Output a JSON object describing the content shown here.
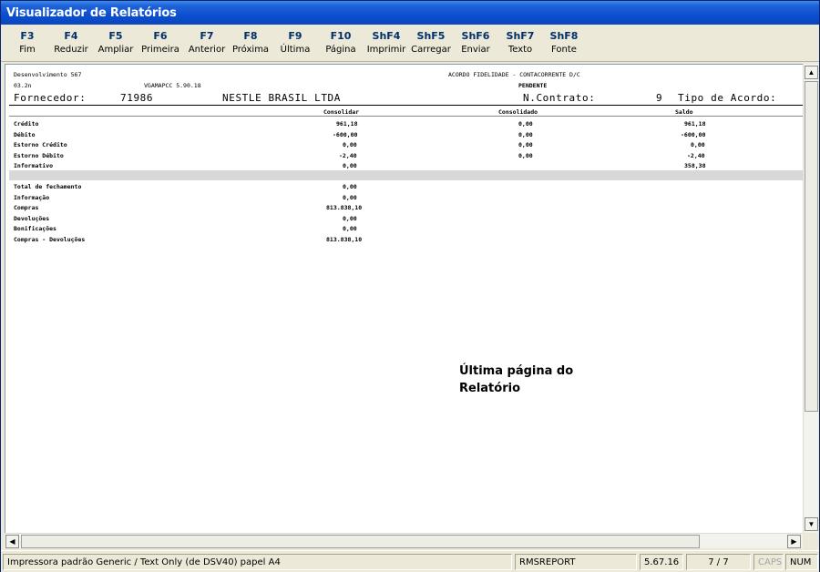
{
  "window": {
    "title": "Visualizador de Relatórios"
  },
  "toolbar": {
    "buttons": [
      {
        "key": "F3",
        "label": "Fim"
      },
      {
        "key": "F4",
        "label": "Reduzir"
      },
      {
        "key": "F5",
        "label": "Ampliar"
      },
      {
        "key": "F6",
        "label": "Primeira"
      },
      {
        "key": "F7",
        "label": "Anterior"
      },
      {
        "key": "F8",
        "label": "Próxima"
      },
      {
        "key": "F9",
        "label": "Última"
      },
      {
        "key": "F10",
        "label": "Página"
      },
      {
        "key": "ShF4",
        "label": "Imprimir"
      },
      {
        "key": "ShF5",
        "label": "Carregar"
      },
      {
        "key": "ShF6",
        "label": "Enviar"
      },
      {
        "key": "ShF7",
        "label": "Texto"
      },
      {
        "key": "ShF8",
        "label": "Fonte"
      }
    ]
  },
  "report": {
    "header_left1": "Desenvolvimento 567",
    "header_left2": "03.2n",
    "program": "VGAMAPCC 5.90.18",
    "title": "ACORDO FIDELIDADE - CONTACORRENTE D/C",
    "status": "PENDENTE",
    "supplier_label": "Fornecedor:",
    "supplier_code": "71986",
    "supplier_name": "NESTLE BRASIL LTDA",
    "contract_label": "N.Contrato:",
    "contract_number": "9",
    "agreement_type_label": "Tipo de Acordo:",
    "columns": {
      "consolidar": "Consolidar",
      "consolidado": "Consolidado",
      "saldo": "Saldo"
    },
    "rows": [
      {
        "label": "Crédito",
        "consolidar": "961,18",
        "consolidado": "0,00",
        "saldo": "961,18"
      },
      {
        "label": "Débito",
        "consolidar": "-600,00",
        "consolidado": "0,00",
        "saldo": "-600,00"
      },
      {
        "label": "Estorno Crédito",
        "consolidar": "0,00",
        "consolidado": "0,00",
        "saldo": "0,00"
      },
      {
        "label": "Estorno Débito",
        "consolidar": "-2,40",
        "consolidado": "0,00",
        "saldo": "-2,40"
      },
      {
        "label": "Informativo",
        "consolidar": "0,00",
        "consolidado": "",
        "saldo": "358,38"
      }
    ],
    "totals": [
      {
        "label": "Total de fechamento",
        "value": "0,00"
      },
      {
        "label": "Informação",
        "value": "0,00"
      },
      {
        "label": "Compras",
        "value": "813.838,10"
      },
      {
        "label": "Devoluções",
        "value": "0,00"
      },
      {
        "label": "Bonificações",
        "value": "0,00"
      },
      {
        "label": "Compras - Devoluções",
        "value": "813.838,10"
      }
    ],
    "note_line1": "Última página do",
    "note_line2": "Relatório"
  },
  "statusbar": {
    "printer": "Impressora padrão Generic / Text Only (de DSV40) papel A4",
    "module": "RMSREPORT",
    "version": "5.67.16",
    "page": "7 / 7",
    "caps": "CAPS",
    "num": "NUM"
  },
  "colors": {
    "titlebar": "#0b4fd0",
    "key_text": "#00306b",
    "gray_band": "#d8d8d8"
  }
}
